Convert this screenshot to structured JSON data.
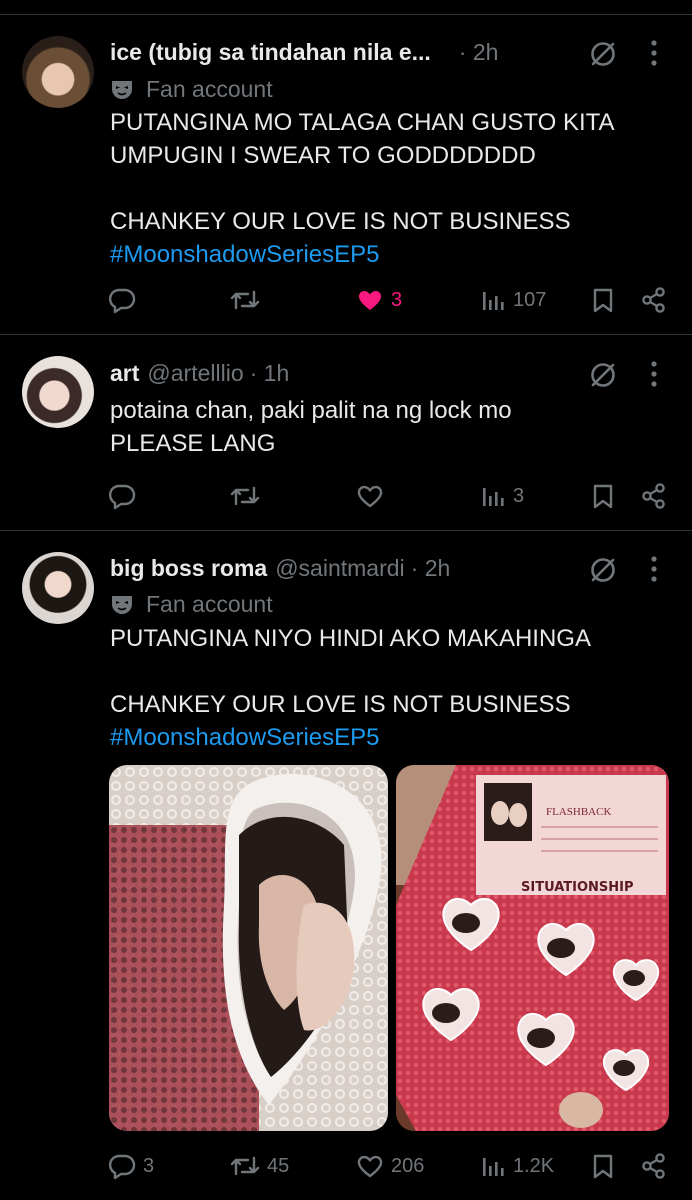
{
  "colors": {
    "background": "#000000",
    "text": "#e7e9ea",
    "muted": "#71767b",
    "link": "#1d9bf0",
    "like": "#f91880",
    "divider": "#2f3336"
  },
  "tweets": [
    {
      "name": "ice (tubig sa tindahan nila e...",
      "handle": "",
      "time": "· 2h",
      "badge": "Fan account",
      "text_lines": [
        "PUTANGINA MO TALAGA CHAN GUSTO KITA",
        "UMPUGIN I SWEAR TO GODDDDDDD"
      ],
      "text_lines_2": [
        "CHANKEY OUR LOVE IS NOT BUSINESS"
      ],
      "hashtag": "#MoonshadowSeriesEP5",
      "replies": "",
      "reposts": "",
      "likes": "3",
      "views": "107",
      "liked": true
    },
    {
      "name": "art",
      "handle": "@artelllio",
      "time": "· 1h",
      "badge": "",
      "text_lines": [
        "potaina chan, paki palit na ng lock mo",
        "PLEASE LANG"
      ],
      "replies": "",
      "reposts": "",
      "likes": "",
      "views": "3",
      "liked": false
    },
    {
      "name": "big boss roma",
      "handle": "@saintmardi",
      "time": "· 2h",
      "badge": "Fan account",
      "text_lines": [
        "PUTANGINA NIYO HINDI AKO MAKAHINGA"
      ],
      "text_lines_2": [
        "CHANKEY OUR LOVE IS NOT BUSINESS"
      ],
      "hashtag": "#MoonshadowSeriesEP5",
      "media": {
        "image2_title": "SITUATIONSHIP",
        "image2_brand": "FLASHBACK"
      },
      "replies": "3",
      "reposts": "45",
      "likes": "206",
      "views": "1.2K",
      "liked": false
    }
  ],
  "icons": [
    "reply-icon",
    "repost-icon",
    "like-icon",
    "views-icon",
    "bookmark-icon",
    "share-icon",
    "grok-icon",
    "more-icon",
    "mask-icon"
  ]
}
